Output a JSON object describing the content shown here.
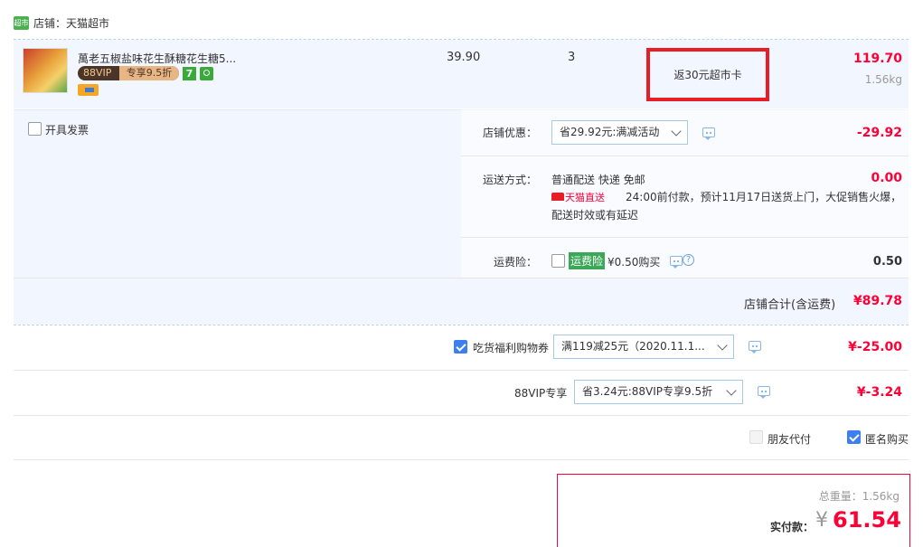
{
  "shop": {
    "label": "店铺：天猫超市",
    "logo_text": "超市"
  },
  "product": {
    "name": "萬老五椒盐味花生酥糖花生糖5...",
    "vip_badge": "88VIP",
    "vip_discount": "专享9.5折",
    "badge_seven": "7",
    "price": "39.90",
    "quantity": "3",
    "promo": "返30元超市卡",
    "subtotal": "119.70",
    "weight": "1.56kg"
  },
  "invoice": {
    "label": "开具发票"
  },
  "store_discount": {
    "label": "店铺优惠：",
    "select": "省29.92元:满减活动",
    "amount": "-29.92"
  },
  "shipping": {
    "label": "运送方式：",
    "method": "普通配送 快递 免邮",
    "amount": "0.00",
    "direct_tag": "天猫直送",
    "note_line1": "24:00前付款，预计11月17日送货上门，大促销售火爆，",
    "note_line2": "配送时效或有延迟"
  },
  "insurance": {
    "label": "运费险：",
    "tag": "运费险",
    "price": "¥0.50购买",
    "amount": "0.50"
  },
  "store_total": {
    "label": "店铺合计(含运费)",
    "amount": "¥89.78"
  },
  "coupon": {
    "label": "吃货福利购物券",
    "select": "满119减25元（2020.11.1...",
    "amount": "¥-25.00"
  },
  "vip": {
    "label": "88VIP专享",
    "select": "省3.24元:88VIP专享9.5折",
    "amount": "¥-3.24"
  },
  "options": {
    "friend_pay": "朋友代付",
    "anonymous": "匿名购买"
  },
  "summary": {
    "weight_label": "总重量：1.56kg",
    "pay_label": "实付款：",
    "currency": "¥",
    "pay_amount": "61.54"
  }
}
